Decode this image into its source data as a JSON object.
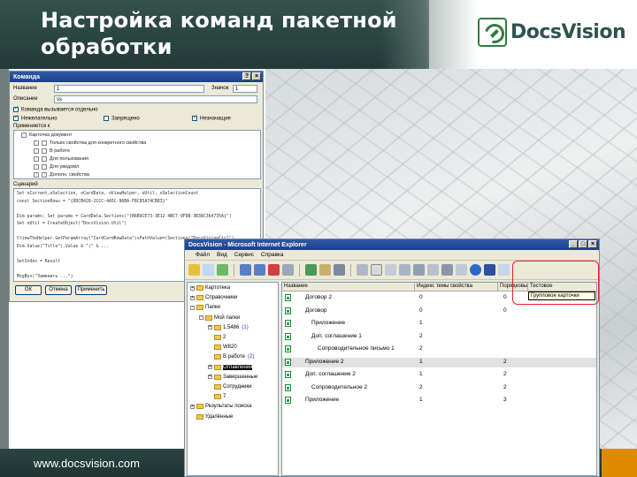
{
  "slide": {
    "title": "Настройка команд пакетной обработки",
    "logo_text": "DocsVision",
    "footer_url": "www.docsvision.com"
  },
  "command_dialog": {
    "title": "Команда",
    "name_label": "Название",
    "name_value": "1",
    "icon_label": "Значок",
    "icon_value": "1",
    "desc_label": "Описание",
    "desc_value": "ss",
    "chk_visible_label": "Команда вызывается отдельно",
    "chk_group1": "Нежелательно",
    "chk_group2": "Запрещено",
    "chk_group3": "Незначащие",
    "selection_label": "Применяется к",
    "tree_items": [
      "Карточка документ",
      "Только свойства для конкретного свойства",
      "В работе",
      "Для пользования",
      "Для уведомл",
      "Дополн. свойства"
    ],
    "script_label": "Сценарий",
    "script_code": "Set oCurrent,oSelection, oCardData, oViewHelper, oUtil, oSelectionCount\nconst SectionRows = \"{ODCB428-2CCC-4A5C-96BA-F8C85A74CB83}\"\n\nDim params: Set params = CardData.Sections(\"{B6B9CE73-3E12-4BC7-9FDB-3B38C364735A}\")\nSet oUtil = CreateObject(\"DocsVision.Util\")\n\nCtiewTheHelper.GetParamArray(\"CardCardRowData\")sPathValue=(Sections(\"DocsVisionCtrl\")\nDim.Value(\"Title\").Value & \"(\" & ... \n\nSetIndex = Result\n\nMsgBox(\"Заменить ...\")\n\nReturn 0",
    "ok": "ОК",
    "cancel": "Отмена",
    "apply": "Применить"
  },
  "ie_window": {
    "title": "DocsVision - Microsoft Internet Explorer",
    "menu": [
      "Файл",
      "Вид",
      "Сервис",
      "Справка"
    ],
    "tooltip": "Групповое карточки",
    "tree": [
      {
        "label": "Картотека",
        "level": 0,
        "exp": "+"
      },
      {
        "label": "Справочники",
        "level": 0,
        "exp": "+"
      },
      {
        "label": "Папки",
        "level": 0,
        "exp": "-"
      },
      {
        "label": "Мой папки",
        "level": 1,
        "exp": "-"
      },
      {
        "label": "1.5486",
        "level": 2,
        "exp": "+",
        "suffix": "(1)"
      },
      {
        "label": "2",
        "level": 2,
        "exp": ""
      },
      {
        "label": "W820",
        "level": 2,
        "exp": ""
      },
      {
        "label": "В работе",
        "level": 2,
        "exp": "",
        "suffix": "(2)"
      },
      {
        "label": "Оглавления",
        "level": 2,
        "exp": "+"
      },
      {
        "label": "Завершенные",
        "level": 2,
        "exp": "+"
      },
      {
        "label": "Сотрудники",
        "level": 2,
        "exp": ""
      },
      {
        "label": "7",
        "level": 2,
        "exp": ""
      },
      {
        "label": "Результаты поиска",
        "level": 0,
        "exp": "+"
      },
      {
        "label": "Удалённые",
        "level": 0,
        "exp": ""
      }
    ],
    "columns": [
      "Название",
      "Индекс темы свойства",
      "Порядковый",
      "Тестовое"
    ],
    "rows": [
      {
        "name": "Договор 2",
        "indent": 0,
        "c2": "0",
        "c3": "0"
      },
      {
        "name": "Договор",
        "indent": 0,
        "c2": "0",
        "c3": "0"
      },
      {
        "name": "Приложение",
        "indent": 1,
        "c2": "1",
        "c3": ""
      },
      {
        "name": "Доп. соглашение 1",
        "indent": 1,
        "c2": "2",
        "c3": ""
      },
      {
        "name": "Сопроводительное письмо 1",
        "indent": 2,
        "c2": "2",
        "c3": ""
      },
      {
        "name": "Приложение 2",
        "indent": 0,
        "c2": "1",
        "c3": "2"
      },
      {
        "name": "Доп. соглашение 2",
        "indent": 0,
        "c2": "1",
        "c3": "2"
      },
      {
        "name": "Сопроводительное 2",
        "indent": 1,
        "c2": "2",
        "c3": "2"
      },
      {
        "name": "Приложение",
        "indent": 0,
        "c2": "1",
        "c3": "3"
      }
    ]
  }
}
